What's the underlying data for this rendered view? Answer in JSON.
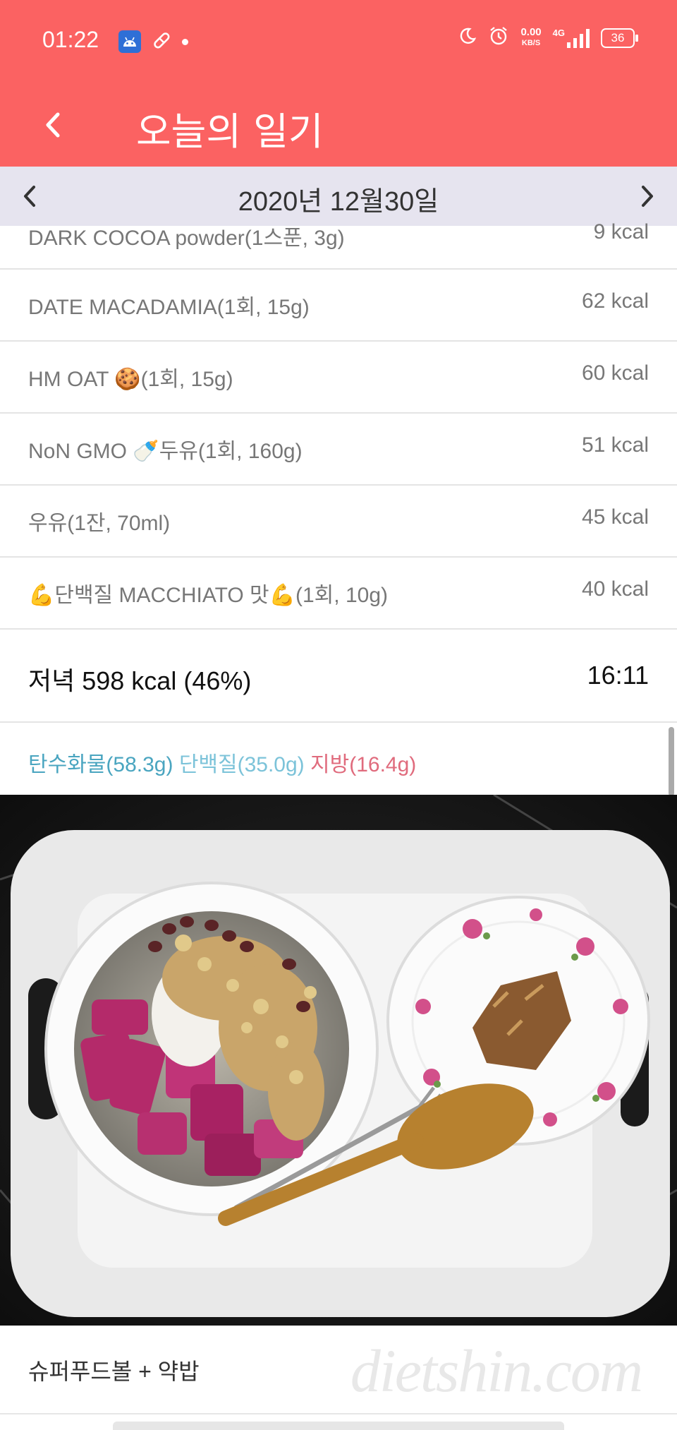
{
  "status_bar": {
    "time": "01:22",
    "net_speed": "0.00",
    "net_unit": "KB/S",
    "net_type": "4G",
    "battery": "36"
  },
  "app_bar": {
    "title": "오늘의 일기"
  },
  "date_nav": {
    "date": "2020년 12월30일"
  },
  "food_items": [
    {
      "name": "DARK COCOA powder(1스푼, 3g)",
      "kcal": "9 kcal"
    },
    {
      "name": "DATE MACADAMIA(1회, 15g)",
      "kcal": "62 kcal"
    },
    {
      "name": "HM OAT 🍪(1회, 15g)",
      "kcal": "60 kcal"
    },
    {
      "name": "NoN GMO 🍼두유(1회, 160g)",
      "kcal": "51 kcal"
    },
    {
      "name": "우유(1잔, 70ml)",
      "kcal": "45 kcal"
    },
    {
      "name": "💪단백질 MACCHIATO 맛💪(1회, 10g)",
      "kcal": "40 kcal"
    }
  ],
  "meal_summary": {
    "label": "저녁 598 kcal (46%)",
    "time": "16:11"
  },
  "macros": {
    "carb": "탄수화물(58.3g)",
    "protein": "단백질(35.0g)",
    "fat": "지방(16.4g)"
  },
  "caption": "슈퍼푸드볼 + 약밥",
  "watermark": "dietshin.com",
  "colors": {
    "header": "#fb6262",
    "date_bar": "#e6e4ef",
    "carb": "#4aa5c0",
    "protein": "#7cc3d9",
    "fat": "#e06b7d"
  }
}
